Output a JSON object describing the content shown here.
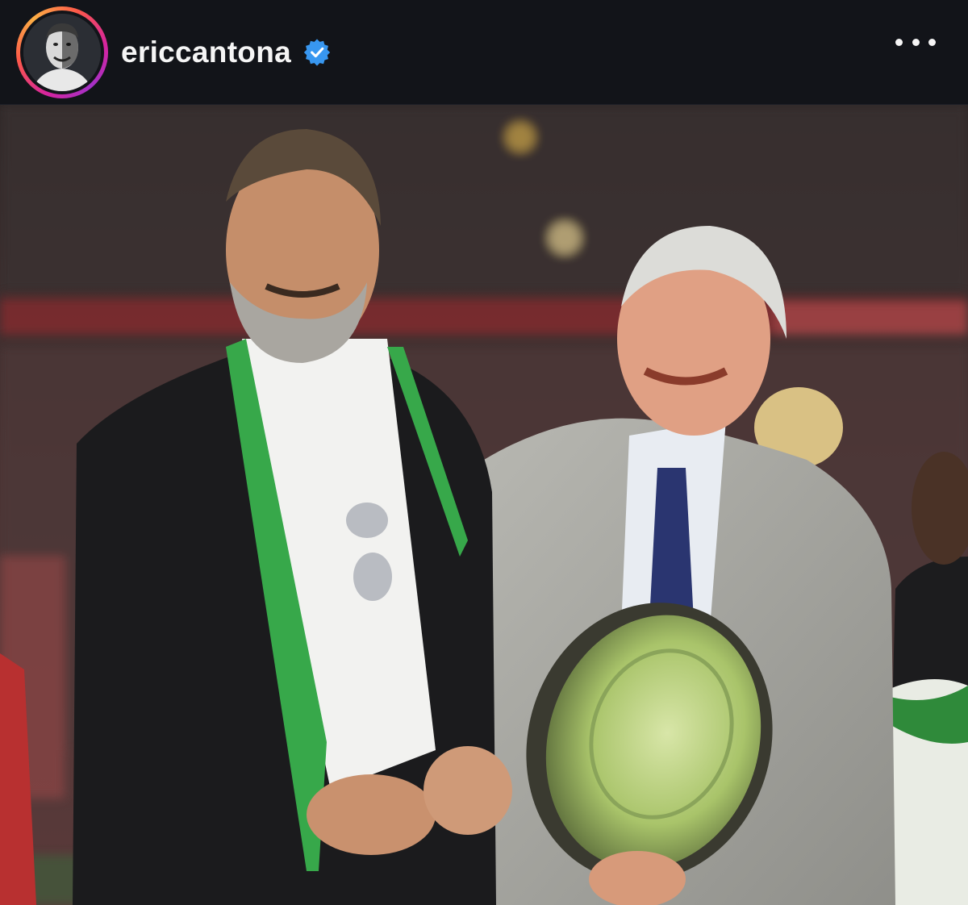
{
  "header": {
    "username": "ericcantona",
    "verified": true,
    "verified_color": "#3897f0",
    "avatar_icon": "profile-avatar",
    "more_icon": "more-options-icon"
  },
  "post": {
    "media_type": "photo",
    "story_ring_colors": [
      "#d6249f",
      "#fd5949",
      "#fcaf45"
    ]
  }
}
